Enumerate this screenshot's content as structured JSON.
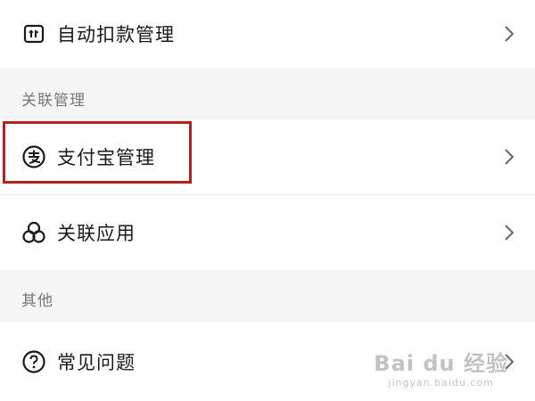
{
  "rows": {
    "auto_debit": {
      "label": "自动扣款管理"
    },
    "alipay": {
      "label": "支付宝管理"
    },
    "linked_apps": {
      "label": "关联应用"
    },
    "faq": {
      "label": "常见问题"
    }
  },
  "sections": {
    "linked_management": {
      "title": "关联管理"
    },
    "other": {
      "title": "其他"
    }
  },
  "icons": {
    "auto_debit": "auto-debit-icon",
    "alipay": "alipay-icon",
    "linked_apps": "linked-apps-icon",
    "faq": "question-icon",
    "chevron": "chevron-right-icon"
  },
  "colors": {
    "highlight_border": "#b4201e",
    "section_text": "#777777",
    "background": "#f5f5f5"
  },
  "watermark": {
    "main": "Bai du 经验",
    "sub": "jingyan.baidu.com"
  }
}
